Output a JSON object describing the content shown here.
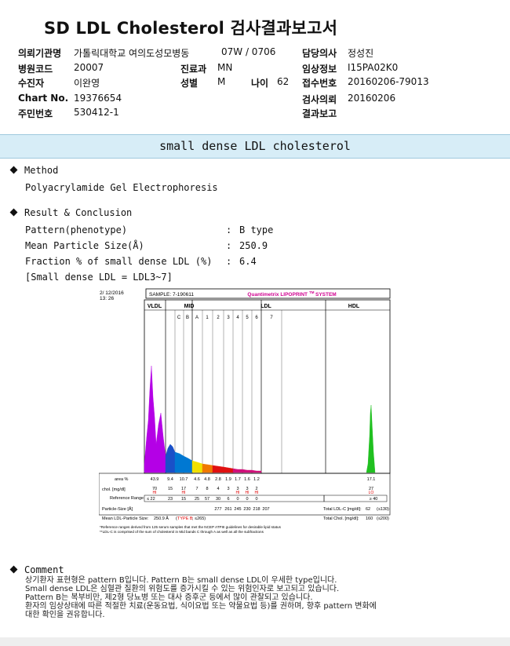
{
  "title": "SD LDL Cholesterol 검사결과보고서",
  "header": {
    "institution_label": "의뢰기관명",
    "institution": "가톨릭대학교 여의도성모병동",
    "ward_label": "",
    "ward_value": "07W / 0706",
    "doctor_label": "담당의사",
    "doctor": "정성진",
    "hospital_code_label": "병원코드",
    "hospital_code": "20007",
    "dept_label": "진료과",
    "dept": "MN",
    "clinical_label": "임상정보",
    "clinical": "I15PA02K0",
    "patient_label": "수진자",
    "patient": "이완영",
    "sex_label": "성별",
    "sex": "M",
    "age_label": "나이",
    "age": "62",
    "receipt_label": "접수번호",
    "receipt": "20160206-79013",
    "chart_label": "Chart No.",
    "chart_no": "19376654",
    "request_label": "검사의뢰",
    "request_date": "20160206",
    "rrn_label": "주민번호",
    "rrn": "530412-1",
    "report_label": "결과보고",
    "report_date": ""
  },
  "section_title": "small dense LDL cholesterol",
  "method": {
    "heading": "Method",
    "text": "Polyacrylamide Gel Electrophoresis"
  },
  "result": {
    "heading": "Result & Conclusion",
    "rows": [
      {
        "label": "Pattern(phenotype)",
        "sep": ":",
        "value": "B type"
      },
      {
        "label": "Mean Particle Size(Å)",
        "sep": ":",
        "value": "250.9"
      },
      {
        "label": "Fraction % of small dense LDL (%)",
        "sep": ":",
        "value": "6.4"
      }
    ],
    "note": "[Small dense LDL = LDL3~7]"
  },
  "lipoprint": {
    "date": "2/ 12/2016",
    "time": "13: 26",
    "sample": "SAMPLE:   7-190611",
    "brand": "Quantimetrix LIPOPRINT",
    "brand_tm": "TM",
    "brand_system": "SYSTEM",
    "regions": {
      "vldl": "VLDL",
      "mid": "MID",
      "ldl": "LDL",
      "hdl": "HDL"
    },
    "bands": [
      "C",
      "B",
      "A",
      "1",
      "2",
      "3",
      "4",
      "5",
      "6",
      "7"
    ],
    "area_label": "area %",
    "area_values": [
      "43.9",
      "9.4",
      "10.7",
      "4.6",
      "4.8",
      "2.8",
      "1.9",
      "1.7",
      "1.6",
      "1.2",
      "",
      "17.1"
    ],
    "chol_label": "chol. [mg/dl]",
    "chol_values": [
      "70",
      "15",
      "17",
      "7",
      "8",
      "4",
      "3",
      "3",
      "3",
      "2",
      "",
      "27"
    ],
    "chol_flags": [
      "HI",
      "",
      "HI",
      "",
      "",
      "",
      "",
      "HI",
      "HI",
      "HI",
      "",
      "LO"
    ],
    "ref_label": "Reference Range",
    "ref_left": "≤ 22",
    "ref_values": [
      "23",
      "15",
      "25",
      "57",
      "30",
      "6",
      "0",
      "0",
      "0"
    ],
    "ref_hdl": "≥ 40",
    "ref_right_label": "Reference Range",
    "particle_label": "Particle-Size [Å]",
    "particle_values": [
      "277",
      "261",
      "245",
      "230",
      "218",
      "207"
    ],
    "total_ldl_label": "Total LDL-C [mg/dl]:",
    "total_ldl": "62",
    "total_ldl_ref": "(≤130)",
    "mean_label": "Mean LDL-Particle Size:",
    "mean_value": "250.9 Å",
    "mean_type_open": "(",
    "mean_type": "TYPE B",
    "mean_type_close": "; ≤265)",
    "total_chol_label": "Total Chol. [mg/dl]:",
    "total_chol": "160",
    "total_chol_ref": "(≤200)",
    "footnote1": "*Reference ranges derived from 125 serum samples that met the NCEP ATPIII guidelines for desirable lipid status",
    "footnote2": "**LDL-C is comprised of the sum of cholesterol in Mid bands C through A as well as all the subfractions"
  },
  "comment": {
    "heading": "Comment",
    "lines": [
      "상기환자 표현형은 pattern B입니다. Pattern B는 small dense LDL이 우세한 type입니다.",
      "Small dense LDL은 심혈관 질환의 위험도를 증가시킬 수 있는 위험인자로 보고되고 있습니다.",
      "Pattern B는 복부비만, 제2형 당뇨병 또는 대사 증후군 등에서 많이 관찰되고 있습니다.",
      "환자의 임상상태에 따른 적절한 치료(운동요법, 식이요법 또는 약물요법 등)를 권하며, 향후 pattern 변화에",
      "대한 확인을 권유합니다."
    ]
  },
  "colors": {
    "band_bg": "#d7edf7",
    "vldl": "#b400e6",
    "mid": "#0078d2",
    "ldl_yellow": "#f0e000",
    "ldl_red": "#e01010",
    "ldl_magenta": "#d0107a",
    "hdl": "#20c020",
    "hi": "#e00000",
    "brand": "#d00090"
  }
}
